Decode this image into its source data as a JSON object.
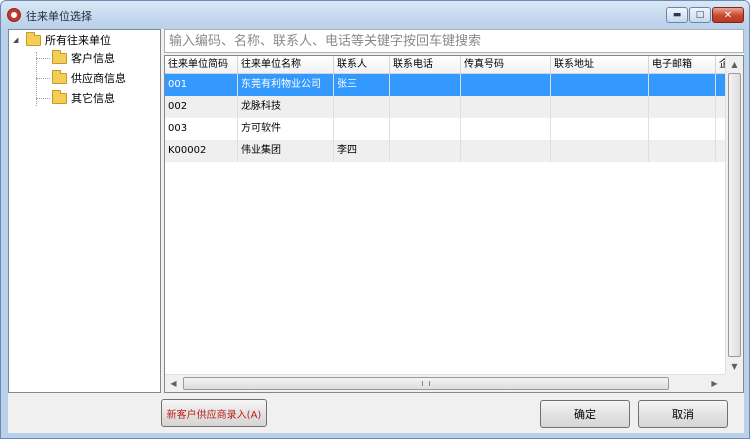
{
  "window": {
    "title": "往来单位选择"
  },
  "controls": {
    "minimize": "▬",
    "maximize": "□",
    "close": "✕"
  },
  "tree": {
    "root": {
      "label": "所有往来单位",
      "expander": "◢"
    },
    "children": [
      {
        "label": "客户信息"
      },
      {
        "label": "供应商信息"
      },
      {
        "label": "其它信息"
      }
    ]
  },
  "search": {
    "placeholder": "输入编码、名称、联系人、电话等关键字按回车键搜索",
    "value": ""
  },
  "table": {
    "columns": [
      "往来单位简码",
      "往来单位名称",
      "联系人",
      "联系电话",
      "传真号码",
      "联系地址",
      "电子邮箱",
      "企"
    ],
    "rows": [
      [
        "001",
        "东莞有利物业公司",
        "张三",
        "",
        "",
        "",
        "",
        ""
      ],
      [
        "002",
        "龙脉科技",
        "",
        "",
        "",
        "",
        "",
        ""
      ],
      [
        "003",
        "方可软件",
        "",
        "",
        "",
        "",
        "",
        ""
      ],
      [
        "K00002",
        "伟业集团",
        "李四",
        "",
        "",
        "",
        "",
        ""
      ]
    ],
    "selected_row": 0
  },
  "scrollbars": {
    "up": "▲",
    "down": "▼",
    "left": "◀",
    "right": "▶"
  },
  "buttons": {
    "new_supplier": "新客户供应商录入(A)",
    "ok": "确定",
    "cancel": "取消"
  }
}
